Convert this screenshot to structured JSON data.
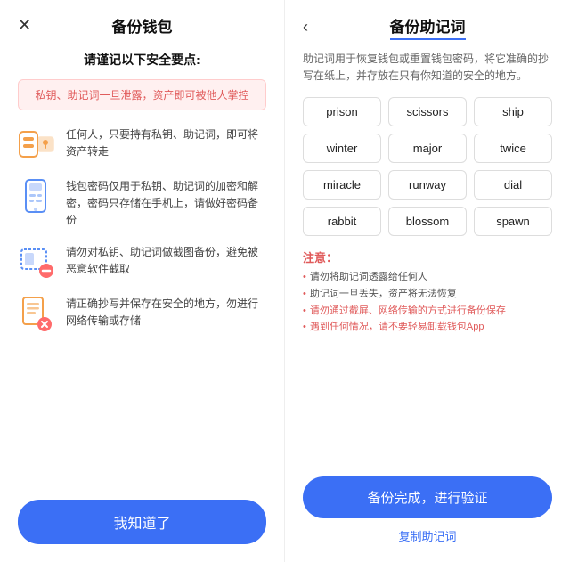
{
  "left": {
    "title": "备份钱包",
    "close_icon": "✕",
    "subtitle": "请谨记以下安全要点:",
    "warning": "私钥、助记词一旦泄露，资产即可被他人掌控",
    "security_items": [
      {
        "id": "key-transfer",
        "text": "任何人，只要持有私钥、助记词，即可将资产转走"
      },
      {
        "id": "password-backup",
        "text": "钱包密码仅用于私钥、助记词的加密和解密，密码只存储在手机上，请做好密码备份"
      },
      {
        "id": "no-screenshot",
        "text": "请勿对私钥、助记词做截图备份，避免被恶意软件截取"
      },
      {
        "id": "safe-copy",
        "text": "请正确抄写并保存在安全的地方，勿进行网络传输或存储"
      }
    ],
    "button_label": "我知道了"
  },
  "right": {
    "title": "备份助记词",
    "back_icon": "‹",
    "description": "助记词用于恢复钱包或重置钱包密码，将它准确的抄写在纸上，并存放在只有你知道的安全的地方。",
    "words": [
      "prison",
      "scissors",
      "ship",
      "winter",
      "major",
      "twice",
      "miracle",
      "runway",
      "dial",
      "rabbit",
      "blossom",
      "spawn"
    ],
    "notice_title": "注意：",
    "notices": [
      {
        "text": "请勿将助记词透露给任何人",
        "red": false
      },
      {
        "text": "助记词一旦丢失，资产将无法恢复",
        "red": false
      },
      {
        "text": "请勿通过截屏、网络传输的方式进行备份保存",
        "red": true
      },
      {
        "text": "遇到任何情况，请不要轻易卸载钱包App",
        "red": true
      }
    ],
    "backup_button": "备份完成，进行验证",
    "copy_link": "复制助记词"
  }
}
